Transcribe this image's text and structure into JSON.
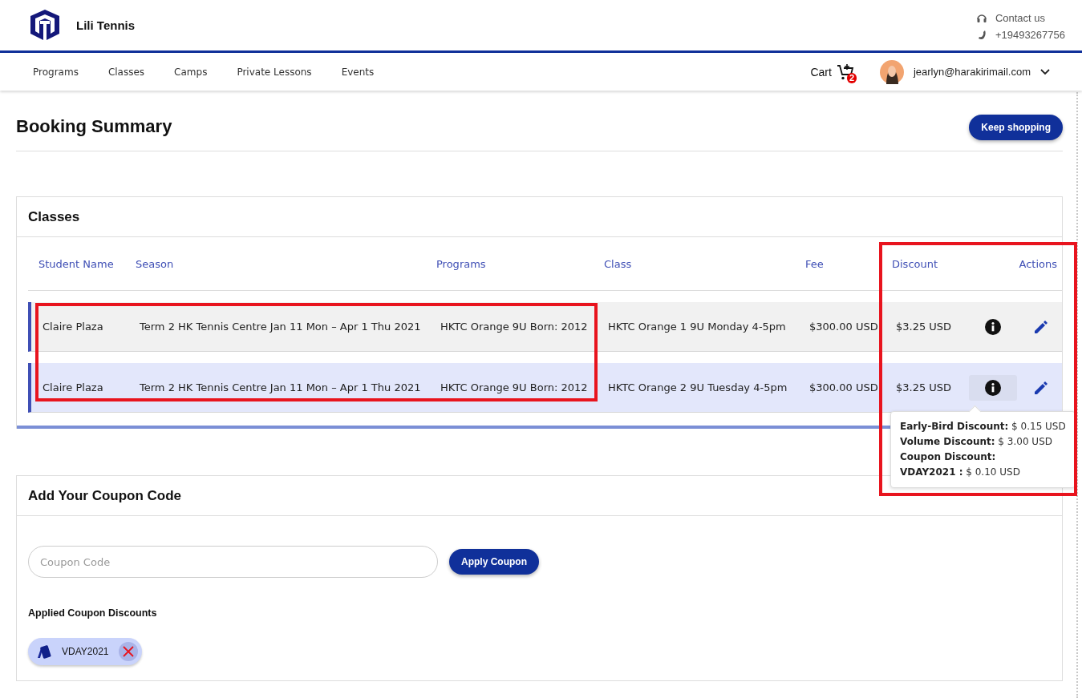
{
  "header": {
    "brand": "Lili Tennis",
    "contact": [
      {
        "kind": "headset",
        "text": "Contact us"
      },
      {
        "kind": "phone",
        "text": "+19493267756"
      }
    ]
  },
  "nav": {
    "items": [
      "Programs",
      "Classes",
      "Camps",
      "Private Lessons",
      "Events"
    ],
    "cart": {
      "label": "Cart",
      "count": "2"
    },
    "user": {
      "email": "jearlyn@harakirimail.com"
    }
  },
  "page": {
    "title": "Booking Summary",
    "action": "Keep shopping"
  },
  "classes": {
    "title": "Classes",
    "columns": [
      {
        "label": "Student Name",
        "rows_boxed": true,
        "column_boxed": false
      },
      {
        "label": "Season",
        "rows_boxed": true,
        "column_boxed": false
      },
      {
        "label": "Programs",
        "rows_boxed": true,
        "column_boxed": false
      },
      {
        "label": "Class",
        "rows_boxed": false,
        "column_boxed": false
      },
      {
        "label": "Fee",
        "rows_boxed": false,
        "column_boxed": false
      },
      {
        "label": "Discount",
        "rows_boxed": false,
        "column_boxed": true
      },
      {
        "label": "Actions",
        "rows_boxed": false,
        "column_boxed": true
      }
    ],
    "rows": [
      {
        "selected": false,
        "cells": [
          "Claire Plaza",
          "Term 2 HK Tennis Centre Jan 11 Mon – Apr 1 Thu 2021",
          "HKTC Orange 9U Born: 2012",
          "HKTC Orange 1 9U Monday 4-5pm",
          "$300.00 USD",
          "$3.25 USD"
        ]
      },
      {
        "selected": true,
        "cells": [
          "Claire Plaza",
          "Term 2 HK Tennis Centre Jan 11 Mon – Apr 1 Thu 2021",
          "HKTC Orange 9U Born: 2012",
          "HKTC Orange 2 9U Tuesday 4-5pm",
          "$300.00 USD",
          "$3.25 USD"
        ],
        "discount_breakdown": [
          "**Early-Bird Discount:** $ 0.15 USD",
          "**Volume Discount:** $ 3.00 USD",
          "**Coupon Discount:**",
          "**VDAY2021 :** $ 0.10 USD"
        ]
      }
    ]
  },
  "coupon": {
    "title": "Add Your Coupon Code",
    "placeholder": "Coupon Code",
    "button": "Apply Coupon",
    "applied_title": "Applied Coupon Discounts",
    "applied": [
      {
        "code": "VDAY2021"
      }
    ]
  }
}
